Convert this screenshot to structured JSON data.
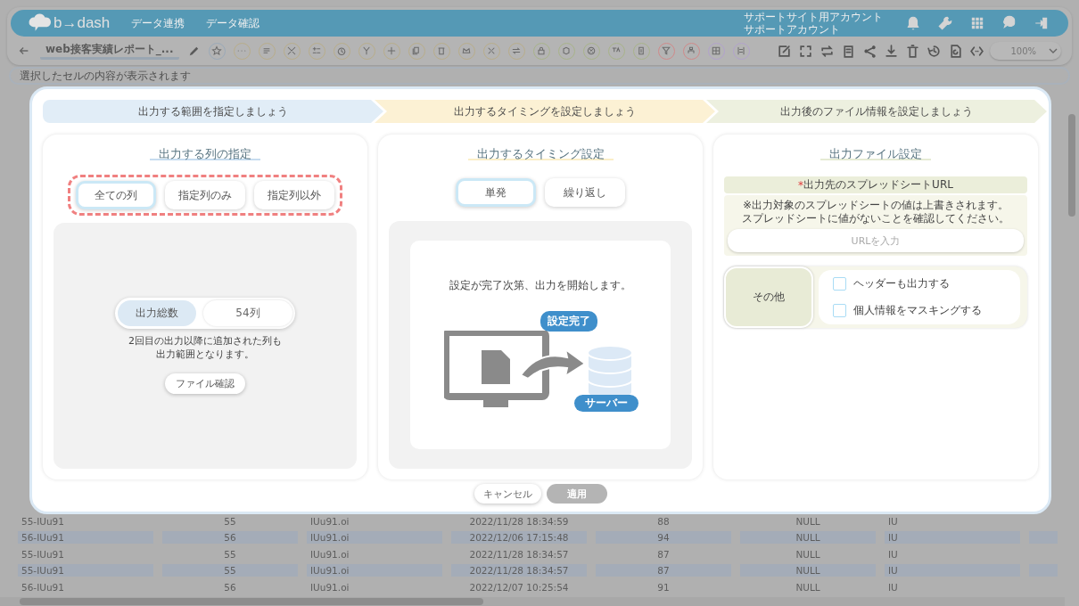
{
  "header": {
    "logo": "b→dash",
    "nav": [
      "データ連携",
      "データ確認"
    ],
    "account": [
      "サポートサイト用アカウント",
      "サポートアカウント"
    ]
  },
  "toolbar": {
    "title": "web接客実績レポート_...",
    "zoom": "100%"
  },
  "search": {
    "placeholder": "選択したセルの内容が表示されます"
  },
  "steps": [
    {
      "label": "出力する範囲を指定しましょう",
      "color": "#e1edf7"
    },
    {
      "label": "出力するタイミングを設定しましょう",
      "color": "#fcf1d4"
    },
    {
      "label": "出力後のファイル情報を設定しましょう",
      "color": "#edf0df"
    }
  ],
  "column_panel": {
    "title": "出力する列の指定",
    "options": [
      {
        "label": "全ての列",
        "selected": true
      },
      {
        "label": "指定列のみ",
        "selected": false
      },
      {
        "label": "指定列以外",
        "selected": false
      }
    ],
    "total_label": "出力総数",
    "total_value": "54列",
    "note": [
      "2回目の出力以降に追加された列も",
      "出力範囲となります。"
    ],
    "button": "ファイル確認"
  },
  "timing_panel": {
    "title": "出力するタイミング設定",
    "options": [
      {
        "label": "単発",
        "selected": true
      },
      {
        "label": "繰り返し",
        "selected": false
      }
    ],
    "message": "設定が完了次第、出力を開始します。",
    "badge_done": "設定完了",
    "badge_server": "サーバー"
  },
  "file_panel": {
    "title": "出力ファイル設定",
    "required_mark": "*",
    "url_label": "出力先のスプレッドシートURL",
    "notes": [
      "※出力対象のスプレッドシートの値は上書きされます。",
      "スプレッドシートに値がないことを確認してください。"
    ],
    "url_placeholder": "URLを入力",
    "other_label": "その他",
    "checks": [
      {
        "label": "ヘッダーも出力する",
        "checked": false
      },
      {
        "label": "個人情報をマスキングする",
        "checked": false
      }
    ]
  },
  "footer": {
    "cancel": "キャンセル",
    "apply": {
      "label": "適用",
      "disabled": true
    }
  },
  "table_rows": [
    {
      "cells": [
        "55-IUu91",
        "55",
        "IUu91.oi",
        "2022/11/28 18:34:59",
        "88",
        "NULL",
        "IU"
      ]
    },
    {
      "cells": [
        "56-IUu91",
        "56",
        "IUu91.oi",
        "2022/12/06 17:15:48",
        "94",
        "NULL",
        "IU"
      ]
    },
    {
      "cells": [
        "55-IUu91",
        "55",
        "IUu91.oi",
        "2022/11/28 18:34:57",
        "87",
        "NULL",
        "IU"
      ]
    },
    {
      "cells": [
        "55-IUu91",
        "55",
        "IUu91.oi",
        "2022/11/28 18:34:57",
        "87",
        "NULL",
        "IU"
      ]
    },
    {
      "cells": [
        "56-IUu91",
        "56",
        "IUu91.oi",
        "2022/12/07 10:25:54",
        "91",
        "NULL",
        "IU"
      ]
    }
  ]
}
